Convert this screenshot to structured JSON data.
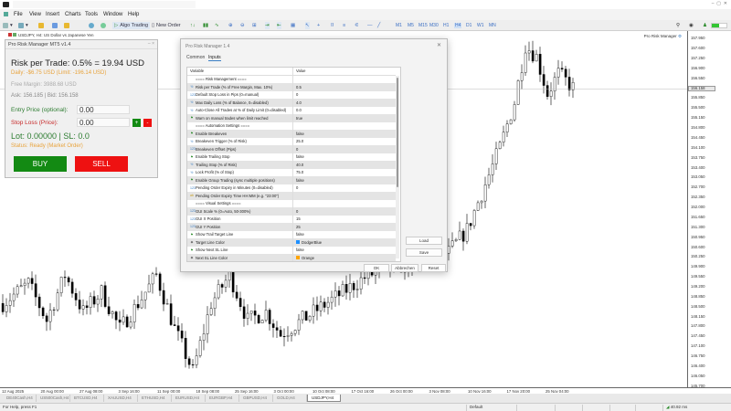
{
  "menu": [
    "File",
    "View",
    "Insert",
    "Charts",
    "Tools",
    "Window",
    "Help"
  ],
  "toolbar": {
    "algo_trading": "Algo Trading",
    "new_order": "New Order",
    "timeframes": [
      "M1",
      "M5",
      "M15",
      "M30",
      "H1",
      "H4",
      "D1",
      "W1",
      "MN"
    ],
    "active_timeframe": "H4"
  },
  "chart": {
    "header": "USDJPY, H4:  US Dollar vs Japanese Yen",
    "indicator_label": "Pro Risk Manager",
    "current_price": "156.158",
    "price_labels": [
      "157.950",
      "157.600",
      "157.250",
      "156.900",
      "156.550",
      "156.200",
      "155.850",
      "155.500",
      "155.150",
      "154.800",
      "154.450",
      "154.100",
      "153.750",
      "153.400",
      "153.050",
      "152.700",
      "152.350",
      "152.000",
      "151.650",
      "151.300",
      "150.950",
      "150.600",
      "150.250",
      "149.900",
      "149.550",
      "149.200",
      "148.850",
      "148.500",
      "148.150",
      "147.800",
      "147.450",
      "147.100",
      "146.750",
      "146.400",
      "146.050",
      "145.700"
    ],
    "date_labels": [
      "12 Aug 2025",
      "20 Aug 00:00",
      "27 Aug 08:00",
      "3 Sep 16:00",
      "11 Sep 00:00",
      "18 Sep 08:00",
      "25 Sep 16:00",
      "3 Oct 00:00",
      "10 Oct 08:00",
      "17 Oct 16:00",
      "26 Oct 00:00",
      "3 Nov 08:00",
      "10 Nov 16:00",
      "17 Nov 20:00",
      "25 Nov 04:00"
    ],
    "price_path": [
      [
        0,
        148.6
      ],
      [
        7,
        149.3
      ],
      [
        12,
        148.0
      ],
      [
        17,
        149.6
      ],
      [
        22,
        148.3
      ],
      [
        27,
        149.0
      ],
      [
        32,
        147.7
      ],
      [
        37,
        148.6
      ],
      [
        42,
        149.6
      ],
      [
        47,
        147.7
      ],
      [
        52,
        146.2
      ],
      [
        57,
        148.6
      ],
      [
        62,
        149.6
      ],
      [
        67,
        148.0
      ],
      [
        72,
        148.3
      ],
      [
        76,
        147.5
      ],
      [
        100,
        149.6
      ],
      [
        122,
        150.4
      ],
      [
        127,
        151.2
      ],
      [
        132,
        152.8
      ],
      [
        136,
        154.1
      ],
      [
        140,
        155.7
      ],
      [
        143,
        157.7
      ],
      [
        146,
        157.3
      ],
      [
        149,
        156.0
      ],
      [
        152,
        156.7
      ],
      [
        156,
        156.2
      ]
    ]
  },
  "risk_panel": {
    "title": "Pro Risk Manager MT5 v1.4",
    "risk_per_trade": "Risk per Trade: 0.5% = 19.94 USD",
    "daily": "Daily: -$6.75 USD (Limit: -196.14 USD)",
    "free_margin": "Free Margin: 3988.68 USD",
    "ask_bid": "Ask: 156.185 | Bid: 156.158",
    "entry_label": "Entry Price (optional):",
    "entry_value": "0.00",
    "sl_label": "Stop Loss (Price):",
    "sl_value": "0.00",
    "plus": "+",
    "minus": "-",
    "lot": "Lot: 0.00000 | SL: 0.0",
    "status": "Status: Ready (Market Order)",
    "buy": "BUY",
    "sell": "SELL",
    "colors": {
      "buy": "#138a13",
      "sell": "#ee1111",
      "status": "#e8a33c",
      "green_text": "#2e7d32",
      "red_text": "#c62828"
    }
  },
  "dialog": {
    "title": "Pro Risk Manager 1.4",
    "tabs": [
      "Common",
      "Inputs"
    ],
    "active_tab": "Inputs",
    "col_variable": "Variable",
    "col_value": "Value",
    "rows": [
      {
        "type": "group",
        "name": "==== Risk Management ====",
        "value": ""
      },
      {
        "type": "num",
        "name": "Risk per Trade (% of Free Margin, Max. 10%)",
        "value": "0.5"
      },
      {
        "type": "int",
        "name": "Default Stop Loss in Pips (0=manual)",
        "value": "0"
      },
      {
        "type": "num",
        "name": "Max Daily Loss (% of Balance, 0=disabled)",
        "value": "4.0"
      },
      {
        "type": "num",
        "name": "Auto-Close All Trades at % of Daily Limit (0=disabled)",
        "value": "0.0"
      },
      {
        "type": "bool",
        "name": "Warn on manual trades when limit reached",
        "value": "true"
      },
      {
        "type": "group",
        "name": "==== Automation Settings ====",
        "value": ""
      },
      {
        "type": "bool",
        "name": "Enable Breakeven",
        "value": "false"
      },
      {
        "type": "num",
        "name": "Breakeven Trigger (% of Risk)",
        "value": "25.0"
      },
      {
        "type": "int",
        "name": "Breakeven Offset (Pips)",
        "value": "0"
      },
      {
        "type": "bool",
        "name": "Enable Trailing Stop",
        "value": "false"
      },
      {
        "type": "num",
        "name": "Trailing Stop (% of Risk)",
        "value": "40.0"
      },
      {
        "type": "num",
        "name": "Lock Profit (% of Stop)",
        "value": "75.0"
      },
      {
        "type": "bool",
        "name": "Enable Group Trading (sync multiple positions)",
        "value": "false"
      },
      {
        "type": "int",
        "name": "Pending Order Expiry in Minutes (0=disabled)",
        "value": "0"
      },
      {
        "type": "str",
        "name": "Pending Order Expiry Time HH:MM (e.g. \"23:00\")",
        "value": ""
      },
      {
        "type": "group",
        "name": "==== Visual Settings ====",
        "value": ""
      },
      {
        "type": "int",
        "name": "GUI Scale % (0=Auto, 50-300%)",
        "value": "0"
      },
      {
        "type": "int",
        "name": "GUI X Position",
        "value": "15"
      },
      {
        "type": "int",
        "name": "GUI Y Position",
        "value": "25"
      },
      {
        "type": "bool",
        "name": "Show Trail Target Line",
        "value": "false"
      },
      {
        "type": "color",
        "name": "Target Line Color",
        "value": "DodgerBlue",
        "swatch": "#1e90ff"
      },
      {
        "type": "bool",
        "name": "Show Next SL Line",
        "value": "false"
      },
      {
        "type": "color",
        "name": "Next SL Line Color",
        "value": "Orange",
        "swatch": "#ffa500"
      }
    ],
    "load": "Load",
    "save": "Save",
    "ok": "OK",
    "cancel": "Abbrechen",
    "reset": "Reset"
  },
  "symbol_tabs": [
    "DE40Cash,H4",
    "US500Cash,H4",
    "BTCUSD,H4",
    "XAUUSD,H4",
    "ETHUSD,H4",
    "EURUSD,H4",
    "EURGBP,H4",
    "GBPUSD,H4",
    "GOLD,H4",
    "USDJPY,H4"
  ],
  "active_symbol_tab": "USDJPY,H4",
  "status": {
    "help": "For Help, press F1",
    "profile": "Default",
    "ping": "40.92 ms"
  }
}
